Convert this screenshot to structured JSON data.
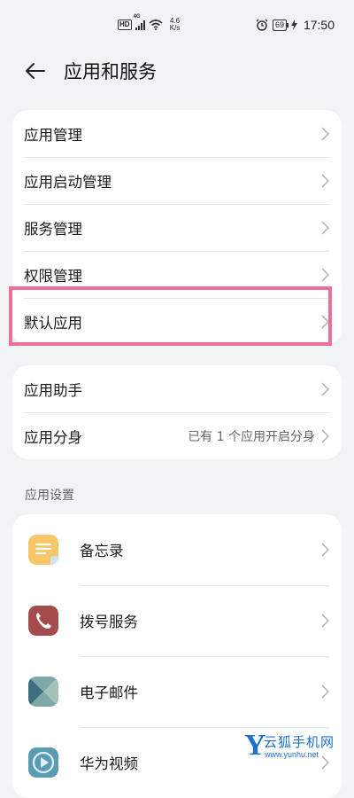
{
  "status_bar": {
    "hd": "HD",
    "network": "4G",
    "speed_value": "4.6",
    "speed_unit": "K/s",
    "battery": "69",
    "time": "17:50"
  },
  "header": {
    "title": "应用和服务"
  },
  "group1": {
    "items": [
      {
        "label": "应用管理"
      },
      {
        "label": "应用启动管理"
      },
      {
        "label": "服务管理"
      },
      {
        "label": "权限管理"
      },
      {
        "label": "默认应用"
      }
    ]
  },
  "group2": {
    "items": [
      {
        "label": "应用助手",
        "value": ""
      },
      {
        "label": "应用分身",
        "value": "已有 1 个应用开启分身"
      }
    ]
  },
  "section": {
    "app_settings": "应用设置"
  },
  "apps": [
    {
      "label": "备忘录",
      "icon": "notepad-icon",
      "color": "#f6c667"
    },
    {
      "label": "拨号服务",
      "icon": "phone-icon",
      "color": "#a44b4b"
    },
    {
      "label": "电子邮件",
      "icon": "mail-icon",
      "color": "#5d8f93"
    },
    {
      "label": "华为视频",
      "icon": "video-play-icon",
      "color": "#5b9bb4"
    }
  ],
  "colors": {
    "highlight": "#ec6f98",
    "background": "#f1f3f5",
    "watermark": "#1e6fd0"
  },
  "watermark": {
    "letter": "Y",
    "name": "云狐手机网",
    "url": "www.yunhu.net"
  }
}
